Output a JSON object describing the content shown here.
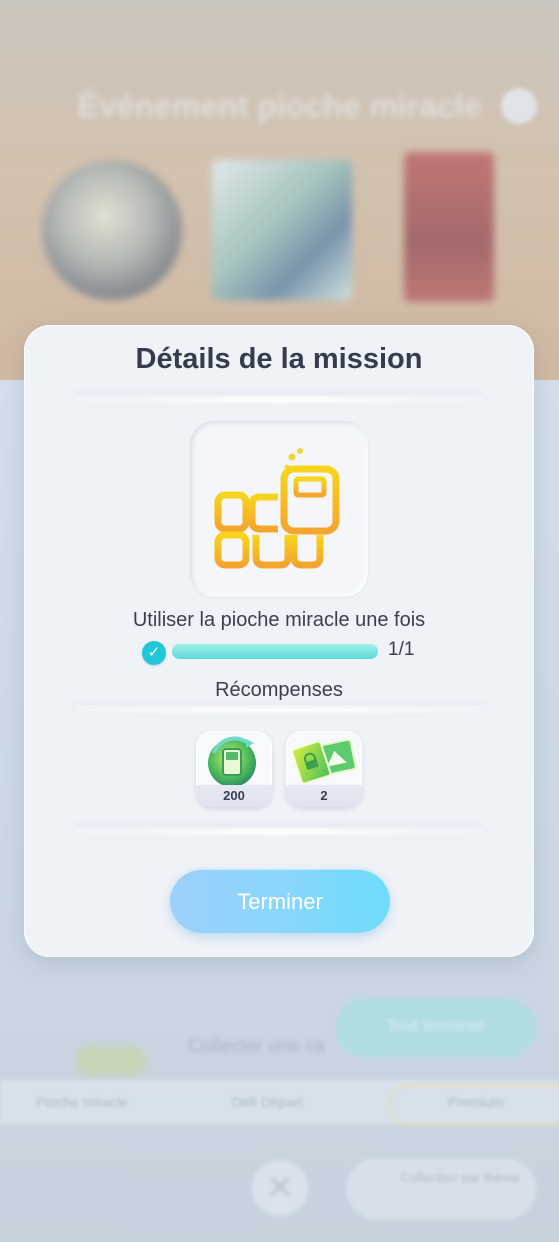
{
  "background": {
    "event_title": "Événement pioche miracle",
    "mission_row_text": "Collecter une ca",
    "complete_all_label": "Tout terminer",
    "tabs": [
      "Pioche miracle",
      "Défi Départ",
      "Premium"
    ],
    "collection_button_label": "Collection par thème"
  },
  "modal": {
    "title": "Détails de la mission",
    "mission_icon": "miracle-pick-icon",
    "mission_description": "Utiliser la pioche miracle une fois",
    "progress": {
      "current": 1,
      "total": 1,
      "label": "1/1",
      "completed": true
    },
    "rewards_heading": "Récompenses",
    "rewards": [
      {
        "icon": "hourglass-token-icon",
        "quantity": "200"
      },
      {
        "icon": "card-pack-ticket-icon",
        "quantity": "2"
      }
    ],
    "finish_button_label": "Terminer"
  },
  "colors": {
    "accent_cyan": "#1fc7d9",
    "progress_fill": "#5ed7d8",
    "button_gradient_start": "#9cd0fb",
    "button_gradient_end": "#6fdcfb",
    "title_text": "#353c4d"
  }
}
